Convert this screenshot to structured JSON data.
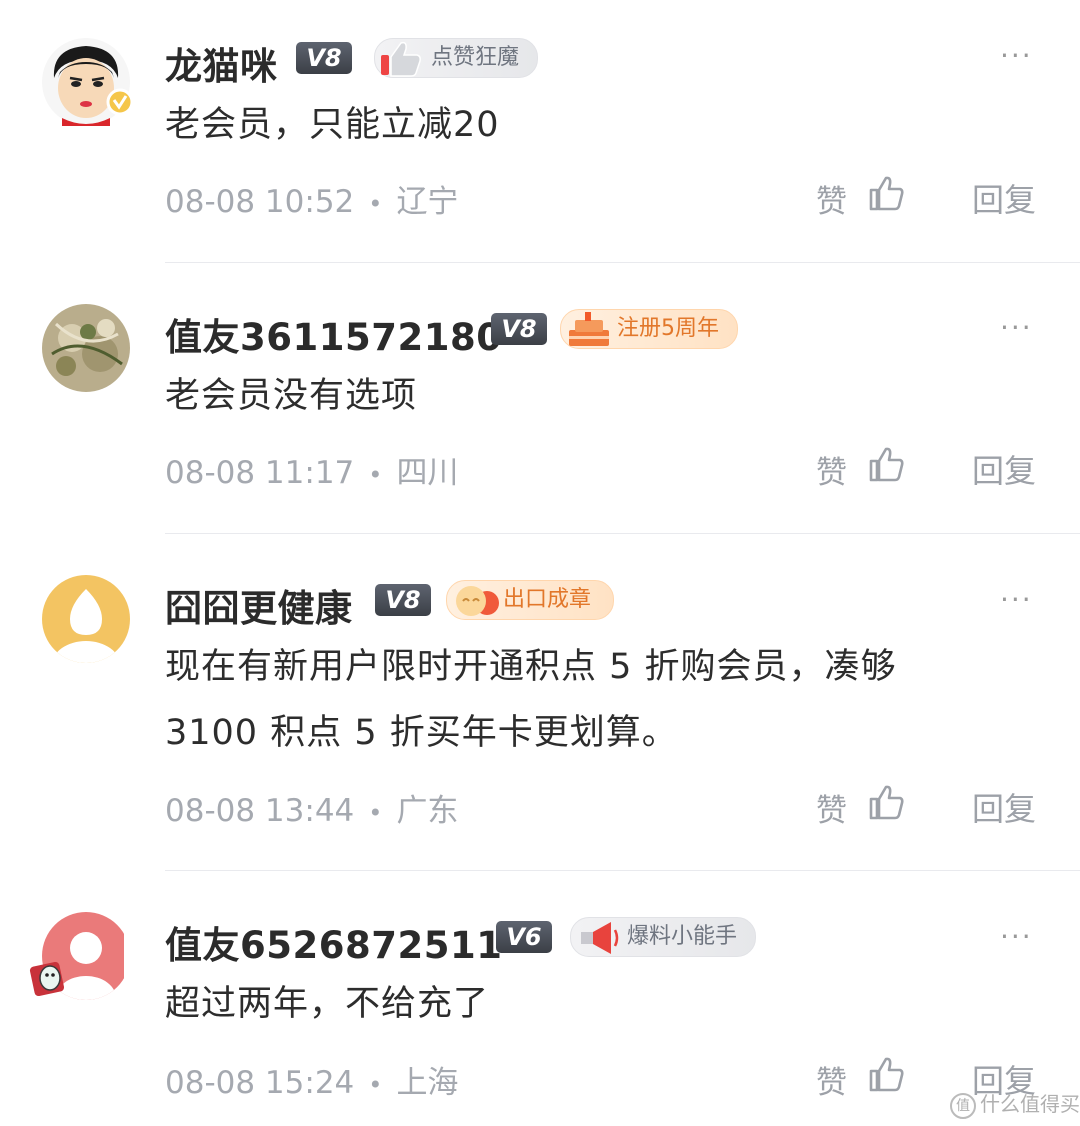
{
  "comments": [
    {
      "name": "龙猫咪",
      "level": "V8",
      "badge": "点赞狂魔",
      "badge_style": "gray",
      "badge_icon": "thumbs-up-badge-icon",
      "text": "老会员，只能立减20",
      "time": "08-08 10:52",
      "location": "辽宁",
      "like_label": "赞",
      "reply_label": "回复",
      "more": "···",
      "avatar": "cartoon-face-avatar"
    },
    {
      "name": "值友3611572180",
      "level": "V8",
      "badge": "注册5周年",
      "badge_style": "orange",
      "badge_icon": "cake-badge-icon",
      "text": "老会员没有选项",
      "time": "08-08 11:17",
      "location": "四川",
      "like_label": "赞",
      "reply_label": "回复",
      "more": "···",
      "avatar": "food-photo-avatar"
    },
    {
      "name": "囧囧更健康",
      "level": "V8",
      "badge": "出口成章",
      "badge_style": "orange",
      "badge_icon": "emoji-badge-icon",
      "text_lines": [
        "现在有新用户限时开通积点 5 折购会员，凑够",
        "3100 积点 5 折买年卡更划算。"
      ],
      "time": "08-08 13:44",
      "location": "广东",
      "like_label": "赞",
      "reply_label": "回复",
      "more": "···",
      "avatar": "default-yellow-avatar"
    },
    {
      "name": "值友6526872511",
      "level": "V6",
      "badge": "爆料小能手",
      "badge_style": "gray",
      "badge_icon": "megaphone-badge-icon",
      "text": "超过两年，不给充了",
      "time": "08-08 15:24",
      "location": "上海",
      "like_label": "赞",
      "reply_label": "回复",
      "more": "···",
      "avatar": "default-red-avatar"
    }
  ],
  "watermark": "什么值得买",
  "colors": {
    "meta": "#a5a9b0",
    "badge_orange": "#e2772a",
    "badge_gray": "#6f7580",
    "level_bg": "#3b3f46"
  }
}
